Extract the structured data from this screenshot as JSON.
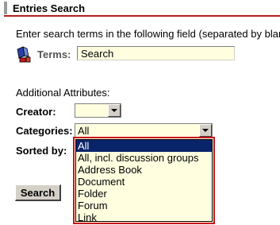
{
  "header": {
    "title": "Entries Search"
  },
  "instructions": "Enter search terms in the following field (separated by blank",
  "terms": {
    "label": "Terms:",
    "value": "Search"
  },
  "attributes": {
    "heading": "Additional Attributes:",
    "creator": {
      "label": "Creator:",
      "value": ""
    },
    "categories": {
      "label": "Categories:",
      "value": "All",
      "options": [
        "All",
        "All, incl. discussion groups",
        "Address Book",
        "Document",
        "Folder",
        "Forum",
        "Link"
      ],
      "selected_index": 0
    },
    "sorted_by": {
      "label": "Sorted by:"
    }
  },
  "search_button": {
    "label": "Search"
  },
  "colors": {
    "accent": "#b0201d",
    "field_bg": "#ffffe0",
    "selection": "#0a246a",
    "dropdown_border": "#c8161d"
  }
}
